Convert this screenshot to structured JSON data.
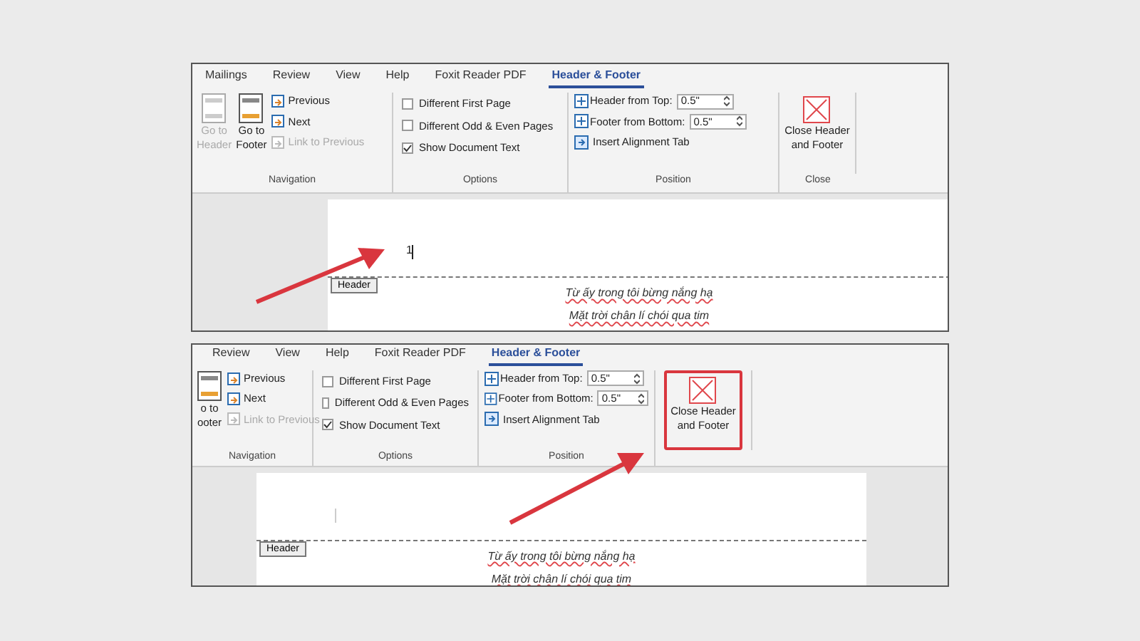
{
  "panels": [
    {
      "tabs": [
        {
          "label": "Mailings",
          "selected": false
        },
        {
          "label": "Review",
          "selected": false
        },
        {
          "label": "View",
          "selected": false
        },
        {
          "label": "Help",
          "selected": false
        },
        {
          "label": "Foxit Reader PDF",
          "selected": false
        },
        {
          "label": "Header & Footer",
          "selected": true
        }
      ],
      "navigation": {
        "big_buttons": [
          {
            "lines": [
              "Go to",
              "Header"
            ],
            "disabled": true
          },
          {
            "lines": [
              "Go to",
              "Footer"
            ],
            "disabled": false
          }
        ],
        "small_buttons": [
          {
            "label": "Previous",
            "disabled": false
          },
          {
            "label": "Next",
            "disabled": false
          },
          {
            "label": "Link to Previous",
            "disabled": true
          }
        ],
        "group_label": "Navigation"
      },
      "options": {
        "items": [
          {
            "label": "Different First Page",
            "checked": false
          },
          {
            "label": "Different Odd & Even Pages",
            "checked": false
          },
          {
            "label": "Show Document Text",
            "checked": true
          }
        ],
        "group_label": "Options"
      },
      "position": {
        "fields": [
          {
            "label": "Header from Top:",
            "value": "0.5\""
          },
          {
            "label": "Footer from Bottom:",
            "value": "0.5\""
          }
        ],
        "insert": "Insert Alignment Tab",
        "group_label": "Position"
      },
      "close": {
        "lines": [
          "Close Header",
          "and Footer"
        ],
        "highlighted": false,
        "group_label": "Close"
      },
      "document": {
        "header_text": "1",
        "header_tag": "Header",
        "lines": [
          "Từ ấy trong tôi bừng nắng hạ",
          "Mặt trời chân lí chói qua tim"
        ]
      }
    },
    {
      "tabs": [
        {
          "label": "Review",
          "selected": false
        },
        {
          "label": "View",
          "selected": false
        },
        {
          "label": "Help",
          "selected": false
        },
        {
          "label": "Foxit Reader PDF",
          "selected": false
        },
        {
          "label": "Header & Footer",
          "selected": true
        }
      ],
      "navigation": {
        "big_buttons": [
          {
            "lines": [
              "o to",
              "ooter"
            ],
            "disabled": false
          }
        ],
        "small_buttons": [
          {
            "label": "Previous",
            "disabled": false
          },
          {
            "label": "Next",
            "disabled": false
          },
          {
            "label": "Link to Previous",
            "disabled": true
          }
        ],
        "group_label": "Navigation"
      },
      "options": {
        "items": [
          {
            "label": "Different First Page",
            "checked": false
          },
          {
            "label": "Different Odd & Even Pages",
            "checked": false
          },
          {
            "label": "Show Document Text",
            "checked": true
          }
        ],
        "group_label": "Options"
      },
      "position": {
        "fields": [
          {
            "label": "Header from Top:",
            "value": "0.5\""
          },
          {
            "label": "Footer from Bottom:",
            "value": "0.5\""
          }
        ],
        "insert": "Insert Alignment Tab",
        "group_label": "Position"
      },
      "close": {
        "lines": [
          "Close Header",
          "and Footer"
        ],
        "highlighted": true
      },
      "document": {
        "header_tag": "Header",
        "lines": [
          "Từ ấy trong tôi bừng nắng hạ",
          "Mặt trời chân lí chói qua tim"
        ]
      }
    }
  ]
}
